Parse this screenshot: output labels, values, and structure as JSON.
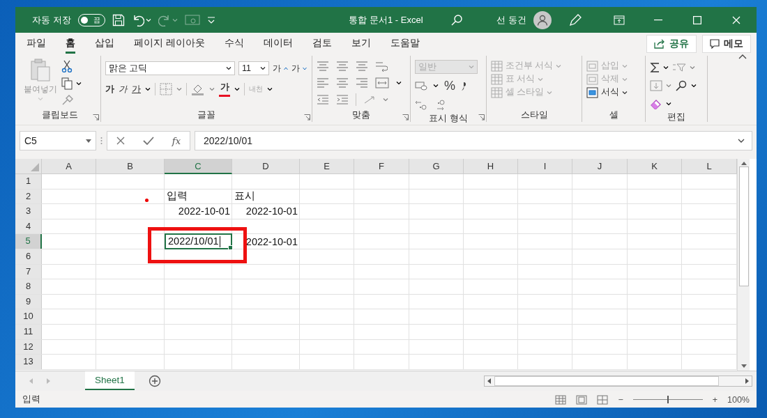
{
  "title_bar": {
    "autosave_label": "자동 저장",
    "autosave_toggle": {
      "label": "끔",
      "on": false
    },
    "title": "통합 문서1  -  Excel",
    "user": "선 동건"
  },
  "ribbon_tabs": [
    {
      "label": "파일",
      "selected": false
    },
    {
      "label": "홈",
      "selected": true
    },
    {
      "label": "삽입",
      "selected": false
    },
    {
      "label": "페이지 레이아웃",
      "selected": false
    },
    {
      "label": "수식",
      "selected": false
    },
    {
      "label": "데이터",
      "selected": false
    },
    {
      "label": "검토",
      "selected": false
    },
    {
      "label": "보기",
      "selected": false
    },
    {
      "label": "도움말",
      "selected": false
    }
  ],
  "share_button": "공유",
  "comments_button": "메모",
  "ribbon": {
    "clipboard": {
      "paste": "붙여넣기",
      "label": "클립보드"
    },
    "font": {
      "name": "맑은 고딕",
      "size": "11",
      "grow": "가",
      "shrink": "가",
      "bold": "가",
      "italic": "가",
      "underline": "가",
      "font_color": "가",
      "phonetic": "내천",
      "label": "글꼴"
    },
    "alignment": {
      "label": "맞춤"
    },
    "number": {
      "format": "일반",
      "percent": "%",
      "label": "표시 형식"
    },
    "styles": {
      "items": [
        {
          "label": "조건부 서식",
          "disabled": true
        },
        {
          "label": "표 서식",
          "disabled": true
        },
        {
          "label": "셀 스타일",
          "disabled": true
        }
      ],
      "label": "스타일"
    },
    "cells": {
      "items": [
        {
          "label": "삽입",
          "disabled": true
        },
        {
          "label": "삭제",
          "disabled": true
        },
        {
          "label": "서식",
          "disabled": false
        }
      ],
      "label": "셀"
    },
    "editing": {
      "label": "편집"
    }
  },
  "formula_bar": {
    "name_box": "C5",
    "fx": "fx",
    "formula": "2022/10/01"
  },
  "sheet": {
    "columns": [
      {
        "label": "A",
        "selected": false
      },
      {
        "label": "B",
        "selected": false
      },
      {
        "label": "C",
        "selected": true
      },
      {
        "label": "D",
        "selected": false
      },
      {
        "label": "E",
        "selected": false
      },
      {
        "label": "F",
        "selected": false
      },
      {
        "label": "G",
        "selected": false
      },
      {
        "label": "H",
        "selected": false
      },
      {
        "label": "I",
        "selected": false
      },
      {
        "label": "J",
        "selected": false
      },
      {
        "label": "K",
        "selected": false
      },
      {
        "label": "L",
        "selected": false
      }
    ],
    "rows": [
      {
        "label": "1",
        "selected": false
      },
      {
        "label": "2",
        "selected": false,
        "cells": [
          {
            "kind": "empty"
          },
          {
            "kind": "empty"
          },
          {
            "text": "입력",
            "kind": "text"
          },
          {
            "text": "표시",
            "kind": "text"
          }
        ]
      },
      {
        "label": "3",
        "selected": false,
        "cells": [
          {
            "kind": "empty"
          },
          {
            "kind": "empty"
          },
          {
            "text": "2022-10-01",
            "kind": "number"
          },
          {
            "text": "2022-10-01",
            "kind": "number"
          }
        ]
      },
      {
        "label": "4",
        "selected": false
      },
      {
        "label": "5",
        "selected": true,
        "cells": [
          {
            "kind": "empty"
          },
          {
            "kind": "empty"
          },
          {
            "text": "2022/10/01",
            "kind": "editing"
          },
          {
            "text": "2022-10-01",
            "kind": "number"
          }
        ]
      },
      {
        "label": "6",
        "selected": false
      },
      {
        "label": "7",
        "selected": false
      },
      {
        "label": "8",
        "selected": false
      },
      {
        "label": "9",
        "selected": false
      },
      {
        "label": "10",
        "selected": false
      },
      {
        "label": "11",
        "selected": false
      },
      {
        "label": "12",
        "selected": false
      },
      {
        "label": "13",
        "selected": false
      }
    ]
  },
  "sheet_tabs": [
    {
      "label": "Sheet1",
      "selected": true
    }
  ],
  "status_bar": {
    "mode": "입력",
    "zoom_out": "−",
    "zoom_in": "+",
    "zoom": "100%",
    "zoom_slider": {
      "level": 0.5
    }
  }
}
